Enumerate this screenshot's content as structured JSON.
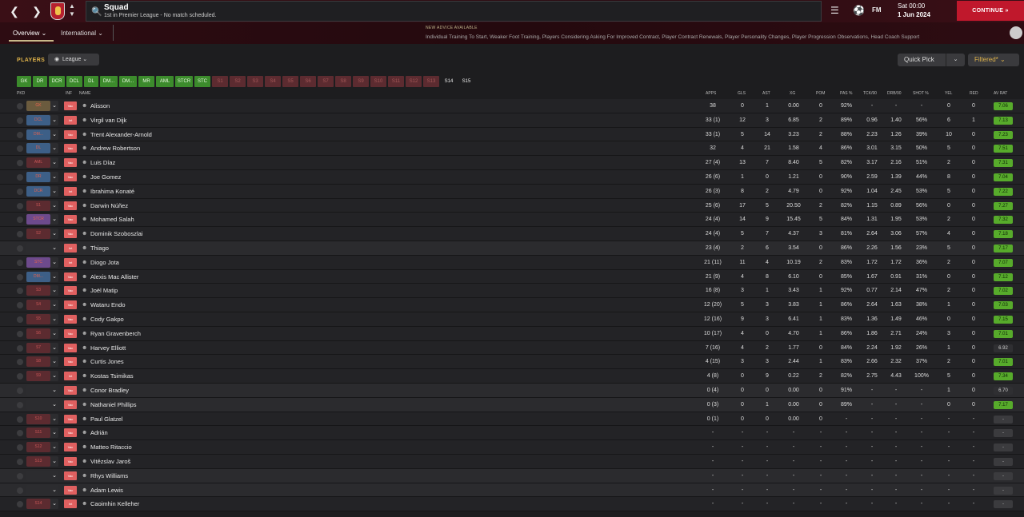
{
  "header": {
    "title": "Squad",
    "subtitle": "1st in Premier League - No match scheduled.",
    "date_day": "Sat 00:00",
    "date_date": "1 Jun 2024",
    "continue_label": "CONTINUE",
    "fm_label": "FM"
  },
  "tabs": {
    "overview": "Overview",
    "international": "International"
  },
  "advice": {
    "title": "NEW ADVICE AVAILABLE",
    "text": "Individual Training To Start, Weaker Foot Training, Players Considering Asking For Improved Contract, Player Contract Renewals, Player Personality Changes, Player Progression Observations, Head Coach Support"
  },
  "toolbar": {
    "players_label": "PLAYERS",
    "league_label": "League",
    "quick_pick": "Quick Pick",
    "filtered": "Filtered*"
  },
  "positions": [
    {
      "label": "GK",
      "on": true
    },
    {
      "label": "DR",
      "on": true
    },
    {
      "label": "DCR",
      "on": true
    },
    {
      "label": "DCL",
      "on": true
    },
    {
      "label": "DL",
      "on": true
    },
    {
      "label": "DM...",
      "on": true
    },
    {
      "label": "DM...",
      "on": true
    },
    {
      "label": "MR",
      "on": true
    },
    {
      "label": "AML",
      "on": true
    },
    {
      "label": "STCR",
      "on": true
    },
    {
      "label": "STC",
      "on": true
    },
    {
      "label": "S1",
      "on": false
    },
    {
      "label": "S2",
      "on": false
    },
    {
      "label": "S3",
      "on": false
    },
    {
      "label": "S4",
      "on": false
    },
    {
      "label": "S5",
      "on": false
    },
    {
      "label": "S6",
      "on": false
    },
    {
      "label": "S7",
      "on": false
    },
    {
      "label": "S8",
      "on": false
    },
    {
      "label": "S9",
      "on": false
    },
    {
      "label": "S10",
      "on": false
    },
    {
      "label": "S11",
      "on": false
    },
    {
      "label": "S12",
      "on": false
    },
    {
      "label": "S13",
      "on": false
    },
    {
      "label": "S14",
      "on": null
    },
    {
      "label": "S15",
      "on": null
    }
  ],
  "columns": {
    "pkd": "PKD",
    "inf": "INF",
    "name": "NAME",
    "apps": "APPS",
    "gls": "GLS",
    "ast": "AST",
    "xg": "XG",
    "pom": "POM",
    "pas": "PAS %",
    "tck": "TCK/90",
    "drb": "DRB/90",
    "shot": "SHOT %",
    "yel": "YEL",
    "red": "RED",
    "avrat": "AV RAT"
  },
  "players": [
    {
      "pos": "GK",
      "pc": "gk",
      "inf": "Vac",
      "name": "Alisson",
      "apps": "38",
      "gls": "0",
      "ast": "1",
      "xg": "0.00",
      "pom": "0",
      "pas": "92%",
      "tck": "-",
      "drb": "-",
      "shot": "-",
      "yel": "0",
      "red": "0",
      "rat": "7.06",
      "rs": "green"
    },
    {
      "pos": "DCL",
      "pc": "def",
      "inf": "Int",
      "name": "Virgil van Dijk",
      "apps": "33 (1)",
      "gls": "12",
      "ast": "3",
      "xg": "6.85",
      "pom": "2",
      "pas": "89%",
      "tck": "0.96",
      "drb": "1.40",
      "shot": "56%",
      "yel": "6",
      "red": "1",
      "rat": "7.13",
      "rs": "green"
    },
    {
      "pos": "DM...",
      "pc": "def",
      "inf": "Vac",
      "name": "Trent Alexander-Arnold",
      "apps": "33 (1)",
      "gls": "5",
      "ast": "14",
      "xg": "3.23",
      "pom": "2",
      "pas": "88%",
      "tck": "2.23",
      "drb": "1.26",
      "shot": "39%",
      "yel": "10",
      "red": "0",
      "rat": "7.23",
      "rs": "green"
    },
    {
      "pos": "DL",
      "pc": "def",
      "inf": "Vac",
      "name": "Andrew Robertson",
      "apps": "32",
      "gls": "4",
      "ast": "21",
      "xg": "1.58",
      "pom": "4",
      "pas": "86%",
      "tck": "3.01",
      "drb": "3.15",
      "shot": "50%",
      "yel": "5",
      "red": "0",
      "rat": "7.51",
      "rs": "green"
    },
    {
      "pos": "AML",
      "pc": "red",
      "inf": "Vac",
      "name": "Luis Díaz",
      "apps": "27 (4)",
      "gls": "13",
      "ast": "7",
      "xg": "8.40",
      "pom": "5",
      "pas": "82%",
      "tck": "3.17",
      "drb": "2.16",
      "shot": "51%",
      "yel": "2",
      "red": "0",
      "rat": "7.31",
      "rs": "green"
    },
    {
      "pos": "DR",
      "pc": "def",
      "inf": "Vac",
      "name": "Joe Gomez",
      "apps": "26 (6)",
      "gls": "1",
      "ast": "0",
      "xg": "1.21",
      "pom": "0",
      "pas": "90%",
      "tck": "2.59",
      "drb": "1.39",
      "shot": "44%",
      "yel": "8",
      "red": "0",
      "rat": "7.04",
      "rs": "green"
    },
    {
      "pos": "DCR",
      "pc": "def",
      "inf": "Int",
      "name": "Ibrahima Konaté",
      "apps": "26 (3)",
      "gls": "8",
      "ast": "2",
      "xg": "4.79",
      "pom": "0",
      "pas": "92%",
      "tck": "1.04",
      "drb": "2.45",
      "shot": "53%",
      "yel": "5",
      "red": "0",
      "rat": "7.22",
      "rs": "green"
    },
    {
      "pos": "S1",
      "pc": "red",
      "inf": "Vac",
      "name": "Darwin Núñez",
      "apps": "25 (6)",
      "gls": "17",
      "ast": "5",
      "xg": "20.50",
      "pom": "2",
      "pas": "82%",
      "tck": "1.15",
      "drb": "0.89",
      "shot": "56%",
      "yel": "0",
      "red": "0",
      "rat": "7.27",
      "rs": "green"
    },
    {
      "pos": "STCR",
      "pc": "st",
      "inf": "Vac",
      "name": "Mohamed Salah",
      "apps": "24 (4)",
      "gls": "14",
      "ast": "9",
      "xg": "15.45",
      "pom": "5",
      "pas": "84%",
      "tck": "1.31",
      "drb": "1.95",
      "shot": "53%",
      "yel": "2",
      "red": "0",
      "rat": "7.32",
      "rs": "green"
    },
    {
      "pos": "S2",
      "pc": "red",
      "inf": "Vac",
      "name": "Dominik Szoboszlai",
      "apps": "24 (4)",
      "gls": "5",
      "ast": "7",
      "xg": "4.37",
      "pom": "3",
      "pas": "81%",
      "tck": "2.64",
      "drb": "3.06",
      "shot": "57%",
      "yel": "4",
      "red": "0",
      "rat": "7.18",
      "rs": "green"
    },
    {
      "pos": "",
      "pc": "none",
      "inf": "Int",
      "name": "Thiago",
      "apps": "23 (4)",
      "gls": "2",
      "ast": "6",
      "xg": "3.54",
      "pom": "0",
      "pas": "86%",
      "tck": "2.26",
      "drb": "1.56",
      "shot": "23%",
      "yel": "5",
      "red": "0",
      "rat": "7.17",
      "rs": "green"
    },
    {
      "pos": "STC",
      "pc": "st",
      "inf": "Int",
      "name": "Diogo Jota",
      "apps": "21 (11)",
      "gls": "11",
      "ast": "4",
      "xg": "10.19",
      "pom": "2",
      "pas": "83%",
      "tck": "1.72",
      "drb": "1.72",
      "shot": "36%",
      "yel": "2",
      "red": "0",
      "rat": "7.07",
      "rs": "green"
    },
    {
      "pos": "DM...",
      "pc": "def",
      "inf": "Vac",
      "name": "Alexis Mac Allister",
      "apps": "21 (9)",
      "gls": "4",
      "ast": "8",
      "xg": "6.10",
      "pom": "0",
      "pas": "85%",
      "tck": "1.67",
      "drb": "0.91",
      "shot": "31%",
      "yel": "0",
      "red": "0",
      "rat": "7.12",
      "rs": "green"
    },
    {
      "pos": "S3",
      "pc": "red",
      "inf": "Vac",
      "name": "Joël Matip",
      "apps": "16 (8)",
      "gls": "3",
      "ast": "1",
      "xg": "3.43",
      "pom": "1",
      "pas": "92%",
      "tck": "0.77",
      "drb": "2.14",
      "shot": "47%",
      "yel": "2",
      "red": "0",
      "rat": "7.02",
      "rs": "green"
    },
    {
      "pos": "S4",
      "pc": "red",
      "inf": "Vac",
      "name": "Wataru Endo",
      "apps": "12 (20)",
      "gls": "5",
      "ast": "3",
      "xg": "3.83",
      "pom": "1",
      "pas": "86%",
      "tck": "2.64",
      "drb": "1.63",
      "shot": "38%",
      "yel": "1",
      "red": "0",
      "rat": "7.03",
      "rs": "green"
    },
    {
      "pos": "S5",
      "pc": "red",
      "inf": "Vac",
      "name": "Cody Gakpo",
      "apps": "12 (16)",
      "gls": "9",
      "ast": "3",
      "xg": "6.41",
      "pom": "1",
      "pas": "83%",
      "tck": "1.36",
      "drb": "1.49",
      "shot": "46%",
      "yel": "0",
      "red": "0",
      "rat": "7.15",
      "rs": "green"
    },
    {
      "pos": "S6",
      "pc": "red",
      "inf": "Vac",
      "name": "Ryan Gravenberch",
      "apps": "10 (17)",
      "gls": "4",
      "ast": "0",
      "xg": "4.70",
      "pom": "1",
      "pas": "86%",
      "tck": "1.86",
      "drb": "2.71",
      "shot": "24%",
      "yel": "3",
      "red": "0",
      "rat": "7.01",
      "rs": "green"
    },
    {
      "pos": "S7",
      "pc": "red",
      "inf": "Vac",
      "name": "Harvey Elliott",
      "apps": "7 (16)",
      "gls": "4",
      "ast": "2",
      "xg": "1.77",
      "pom": "0",
      "pas": "84%",
      "tck": "2.24",
      "drb": "1.92",
      "shot": "26%",
      "yel": "1",
      "red": "0",
      "rat": "6.92",
      "rs": "grey"
    },
    {
      "pos": "S8",
      "pc": "red",
      "inf": "Vac",
      "name": "Curtis Jones",
      "apps": "4 (15)",
      "gls": "3",
      "ast": "3",
      "xg": "2.44",
      "pom": "1",
      "pas": "83%",
      "tck": "2.66",
      "drb": "2.32",
      "shot": "37%",
      "yel": "2",
      "red": "0",
      "rat": "7.01",
      "rs": "green"
    },
    {
      "pos": "S9",
      "pc": "red",
      "inf": "Int",
      "name": "Kostas Tsimikas",
      "apps": "4 (8)",
      "gls": "0",
      "ast": "9",
      "xg": "0.22",
      "pom": "2",
      "pas": "82%",
      "tck": "2.75",
      "drb": "4.43",
      "shot": "100%",
      "yel": "5",
      "red": "0",
      "rat": "7.34",
      "rs": "green"
    },
    {
      "pos": "",
      "pc": "none",
      "inf": "Vac",
      "name": "Conor Bradley",
      "apps": "0 (4)",
      "gls": "0",
      "ast": "0",
      "xg": "0.00",
      "pom": "0",
      "pas": "91%",
      "tck": "-",
      "drb": "-",
      "shot": "-",
      "yel": "1",
      "red": "0",
      "rat": "6.70",
      "rs": "grey"
    },
    {
      "pos": "",
      "pc": "none",
      "inf": "Vac",
      "name": "Nathaniel Phillips",
      "apps": "0 (3)",
      "gls": "0",
      "ast": "1",
      "xg": "0.00",
      "pom": "0",
      "pas": "89%",
      "tck": "-",
      "drb": "-",
      "shot": "-",
      "yel": "0",
      "red": "0",
      "rat": "7.17",
      "rs": "green"
    },
    {
      "pos": "S10",
      "pc": "red",
      "inf": "Vac",
      "name": "Paul Glatzel",
      "apps": "0 (1)",
      "gls": "0",
      "ast": "0",
      "xg": "0.00",
      "pom": "0",
      "pas": "-",
      "tck": "-",
      "drb": "-",
      "shot": "-",
      "yel": "-",
      "red": "-",
      "rat": "-",
      "rs": "empty"
    },
    {
      "pos": "S11",
      "pc": "red",
      "inf": "Vac",
      "name": "Adrián",
      "apps": "-",
      "gls": "-",
      "ast": "-",
      "xg": "-",
      "pom": "-",
      "pas": "-",
      "tck": "-",
      "drb": "-",
      "shot": "-",
      "yel": "-",
      "red": "-",
      "rat": "-",
      "rs": "empty"
    },
    {
      "pos": "S12",
      "pc": "red",
      "inf": "Vac",
      "name": "Matteo Ritaccio",
      "apps": "-",
      "gls": "-",
      "ast": "-",
      "xg": "-",
      "pom": "-",
      "pas": "-",
      "tck": "-",
      "drb": "-",
      "shot": "-",
      "yel": "-",
      "red": "-",
      "rat": "-",
      "rs": "empty"
    },
    {
      "pos": "S13",
      "pc": "red",
      "inf": "Vac",
      "name": "Vitězslav Jaroš",
      "apps": "-",
      "gls": "-",
      "ast": "-",
      "xg": "-",
      "pom": "-",
      "pas": "-",
      "tck": "-",
      "drb": "-",
      "shot": "-",
      "yel": "-",
      "red": "-",
      "rat": "-",
      "rs": "empty"
    },
    {
      "pos": "",
      "pc": "none",
      "inf": "Vac",
      "name": "Rhys Williams",
      "apps": "-",
      "gls": "-",
      "ast": "-",
      "xg": "-",
      "pom": "-",
      "pas": "-",
      "tck": "-",
      "drb": "-",
      "shot": "-",
      "yel": "-",
      "red": "-",
      "rat": "-",
      "rs": "empty"
    },
    {
      "pos": "",
      "pc": "none",
      "inf": "Vac",
      "name": "Adam Lewis",
      "apps": "-",
      "gls": "-",
      "ast": "-",
      "xg": "-",
      "pom": "-",
      "pas": "-",
      "tck": "-",
      "drb": "-",
      "shot": "-",
      "yel": "-",
      "red": "-",
      "rat": "-",
      "rs": "empty"
    },
    {
      "pos": "S14",
      "pc": "red",
      "inf": "Int",
      "name": "Caoimhin Kelleher",
      "apps": "-",
      "gls": "-",
      "ast": "-",
      "xg": "-",
      "pom": "-",
      "pas": "-",
      "tck": "-",
      "drb": "-",
      "shot": "-",
      "yel": "-",
      "red": "-",
      "rat": "-",
      "rs": "empty"
    }
  ],
  "colors": {
    "accent_red": "#c0182c",
    "rating_green": "#57ab2b",
    "position_green": "#3c8b2c",
    "header_gold": "#e0b34a"
  }
}
